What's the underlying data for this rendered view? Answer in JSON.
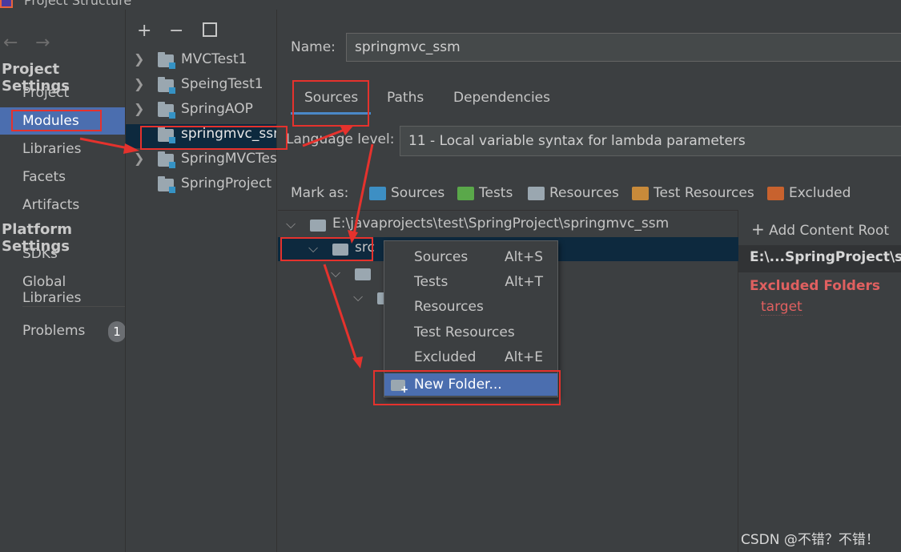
{
  "window": {
    "title": "Project Structure"
  },
  "nav": {
    "back_icon": "arrow-left-icon",
    "forward_icon": "arrow-right-icon",
    "project_settings_heading": "Project Settings",
    "project_settings": [
      "Project",
      "Modules",
      "Libraries",
      "Facets",
      "Artifacts"
    ],
    "platform_settings_heading": "Platform Settings",
    "platform_settings": [
      "SDKs",
      "Global Libraries"
    ],
    "problems_label": "Problems",
    "problems_count": "1",
    "selected": "Modules"
  },
  "modules_toolbar": {
    "add": "+",
    "remove": "−",
    "copy_icon": "copy-icon"
  },
  "modules": [
    {
      "name": "MVCTest1",
      "expandable": true
    },
    {
      "name": "SpeingTest1",
      "expandable": true
    },
    {
      "name": "SpringAOP",
      "expandable": true
    },
    {
      "name": "springmvc_ssm",
      "expandable": false,
      "selected": true
    },
    {
      "name": "SpringMVCTes",
      "expandable": true
    },
    {
      "name": "SpringProject",
      "expandable": false
    }
  ],
  "detail": {
    "name_label": "Name:",
    "name_value": "springmvc_ssm",
    "tabs": [
      "Sources",
      "Paths",
      "Dependencies"
    ],
    "active_tab": "Sources",
    "language_level_label": "Language level:",
    "language_level_value": "11 - Local variable syntax for lambda parameters",
    "mark_as_label": "Mark as:",
    "mark_as": [
      {
        "label": "Sources",
        "color": "#3d8fc4"
      },
      {
        "label": "Tests",
        "color": "#5aa84a"
      },
      {
        "label": "Resources",
        "color": "#9aa7b0"
      },
      {
        "label": "Test Resources",
        "color": "#c88a3a"
      },
      {
        "label": "Excluded",
        "color": "#c8622e"
      }
    ]
  },
  "tree": {
    "root": "E:\\javaprojects\\test\\SpringProject\\springmvc_ssm",
    "src": "src"
  },
  "right_panel": {
    "add_content_root": "Add Content Root",
    "content_root_path": "E:\\...SpringProject\\spr",
    "excluded_heading": "Excluded Folders",
    "excluded_items": [
      "target"
    ]
  },
  "context_menu": [
    {
      "label": "Sources",
      "shortcut": "Alt+S"
    },
    {
      "label": "Tests",
      "shortcut": "Alt+T"
    },
    {
      "label": "Resources",
      "shortcut": ""
    },
    {
      "label": "Test Resources",
      "shortcut": ""
    },
    {
      "label": "Excluded",
      "shortcut": "Alt+E"
    },
    {
      "label": "New Folder...",
      "shortcut": "",
      "selected": true
    }
  ],
  "watermark": "CSDN @不错？不错！"
}
